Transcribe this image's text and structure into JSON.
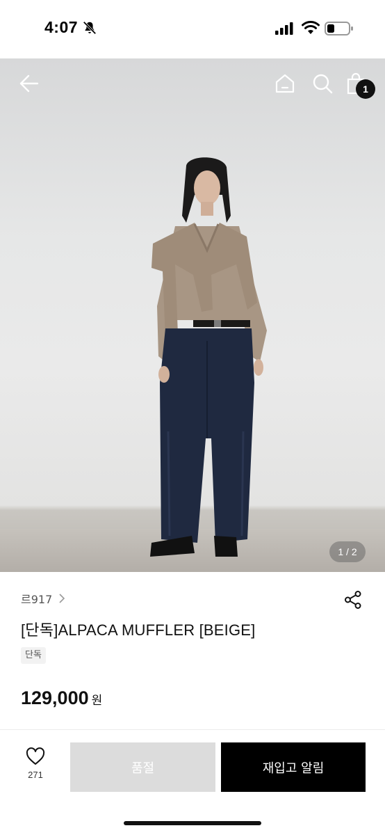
{
  "status_bar": {
    "time": "4:07",
    "icons": [
      "bell-slash-icon",
      "signal-icon",
      "wifi-icon",
      "battery-icon"
    ]
  },
  "header": {
    "icons": [
      "back-arrow-icon",
      "home-icon",
      "search-icon",
      "shopping-bag-icon"
    ],
    "cart_count": "1"
  },
  "gallery": {
    "counter": "1 / 2"
  },
  "product": {
    "brand": "르917",
    "title": "[단독]ALPACA MUFFLER [BEIGE]",
    "tag": "단독",
    "price": "129,000",
    "currency": "원"
  },
  "actions": {
    "like_count": "271",
    "soldout_label": "품절",
    "restock_label": "재입고 알림"
  },
  "colors": {
    "primary_button": "#000000",
    "disabled_button": "#dcdcdc",
    "badge": "#111111"
  }
}
